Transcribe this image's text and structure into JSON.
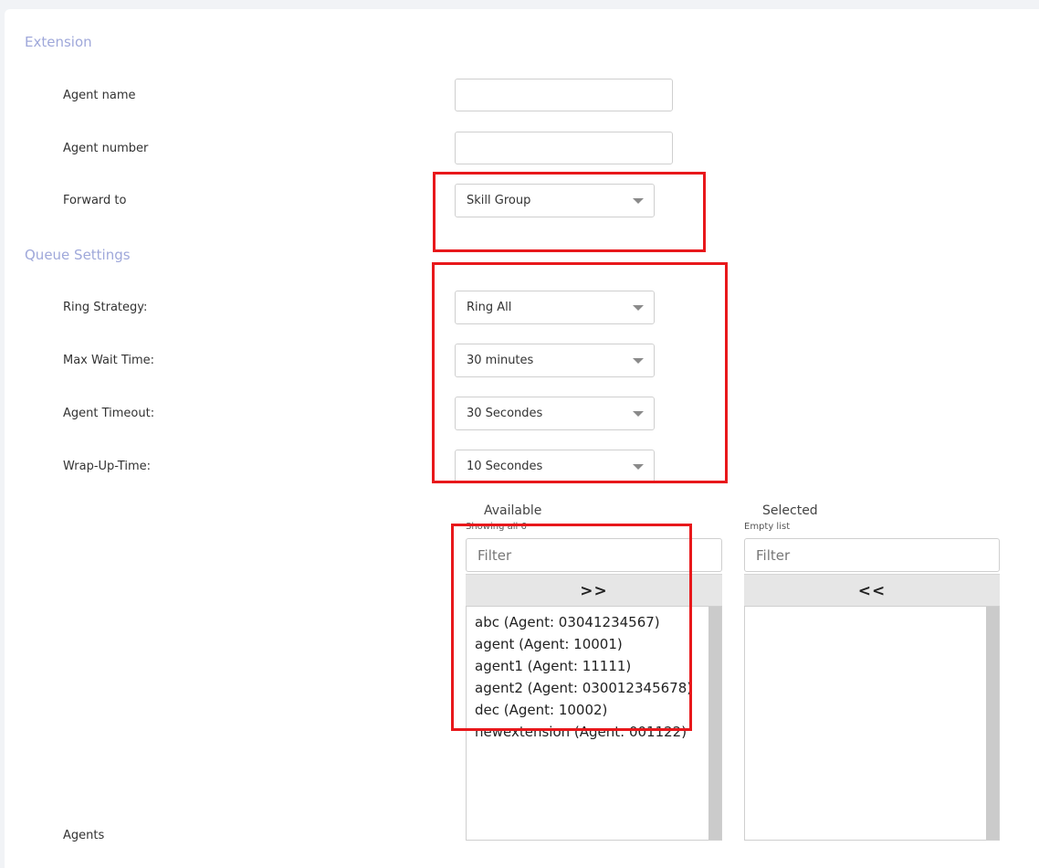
{
  "sections": {
    "extension": "Extension",
    "queue_settings": "Queue Settings"
  },
  "fields": {
    "agent_name": {
      "label": "Agent name",
      "value": ""
    },
    "agent_number": {
      "label": "Agent number",
      "value": ""
    },
    "forward_to": {
      "label": "Forward to",
      "value": "Skill Group"
    },
    "ring_strategy": {
      "label": "Ring Strategy:",
      "value": "Ring All"
    },
    "max_wait_time": {
      "label": "Max Wait Time:",
      "value": "30 minutes"
    },
    "agent_timeout": {
      "label": "Agent Timeout:",
      "value": "30 Secondes"
    },
    "wrap_up_time": {
      "label": "Wrap-Up-Time:",
      "value": "10 Secondes"
    },
    "agents": {
      "label": "Agents"
    }
  },
  "dual_list": {
    "available": {
      "title": "Available",
      "info": "Showing all 6",
      "filter_placeholder": "Filter",
      "move_label": ">>",
      "items": [
        "abc (Agent: 03041234567)",
        "agent (Agent: 10001)",
        "agent1 (Agent: 11111)",
        "agent2 (Agent: 030012345678)",
        "dec (Agent: 10002)",
        "newextension (Agent: 001122)"
      ]
    },
    "selected": {
      "title": "Selected",
      "info": "Empty list",
      "filter_placeholder": "Filter",
      "move_label": "<<",
      "items": []
    }
  },
  "colors": {
    "highlight": "#e8181b",
    "section_heading": "#9fa8da"
  },
  "icons": {
    "dropdown": "caret-down-icon"
  }
}
